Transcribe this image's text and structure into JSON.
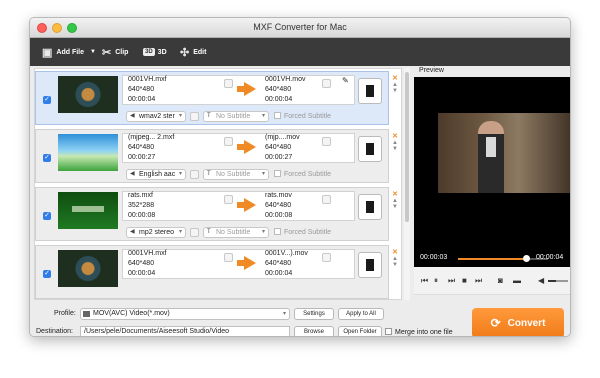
{
  "window": {
    "title": "MXF Converter for Mac"
  },
  "toolbar": {
    "add_file": "Add File",
    "clip": "Clip",
    "three_d": "3D",
    "three_d_badge": "3D",
    "edit": "Edit"
  },
  "files": [
    {
      "src_name": "0001VH.mxf",
      "src_res": "640*480",
      "src_dur": "00:00:04",
      "dst_name": "0001VH.mov",
      "dst_res": "640*480",
      "dst_dur": "00:00:04",
      "audio": "wmav2 ster",
      "subtitle": "No Subtitle",
      "forced": "Forced Subtitle"
    },
    {
      "src_name": "(mjpeg... 2.mxf",
      "src_res": "640*480",
      "src_dur": "00:00:27",
      "dst_name": "(mjp....mov",
      "dst_res": "640*480",
      "dst_dur": "00:00:27",
      "audio": "English aac",
      "subtitle": "No Subtitle",
      "forced": "Forced Subtitle"
    },
    {
      "src_name": "rats.mxf",
      "src_res": "352*288",
      "src_dur": "00:00:08",
      "dst_name": "rats.mov",
      "dst_res": "640*480",
      "dst_dur": "00:00:08",
      "audio": "mp2 stereo",
      "subtitle": "No Subtitle",
      "forced": "Forced Subtitle"
    },
    {
      "src_name": "0001VH.mxf",
      "src_res": "640*480",
      "src_dur": "00:00:04",
      "dst_name": "0001V...).mov",
      "dst_res": "640*480",
      "dst_dur": "00:00:04",
      "audio": "",
      "subtitle": "",
      "forced": ""
    }
  ],
  "preview": {
    "label": "Preview",
    "current_time": "00:00:03",
    "total_time": "00:00:04",
    "progress": 0.75
  },
  "bottom": {
    "profile_label": "Profile:",
    "profile_value": "MOV(AVC) Video(*.mov)",
    "settings": "Settings",
    "apply_all": "Apply to All",
    "destination_label": "Destination:",
    "destination_value": "/Users/pele/Documents/Aiseesoft Studio/Video",
    "browse": "Browse",
    "open_folder": "Open Folder",
    "merge": "Merge into one file",
    "convert": "Convert"
  },
  "icons": [
    "add-file-icon",
    "scissors-icon",
    "3d-icon",
    "edit-icon",
    "pencil-icon",
    "film-icon",
    "speaker-icon",
    "snapshot-icon",
    "folder-icon",
    "volume-icon"
  ],
  "colors": {
    "accent": "#f08a24",
    "toolbar": "#3a3a3a",
    "check": "#2f7de9"
  }
}
